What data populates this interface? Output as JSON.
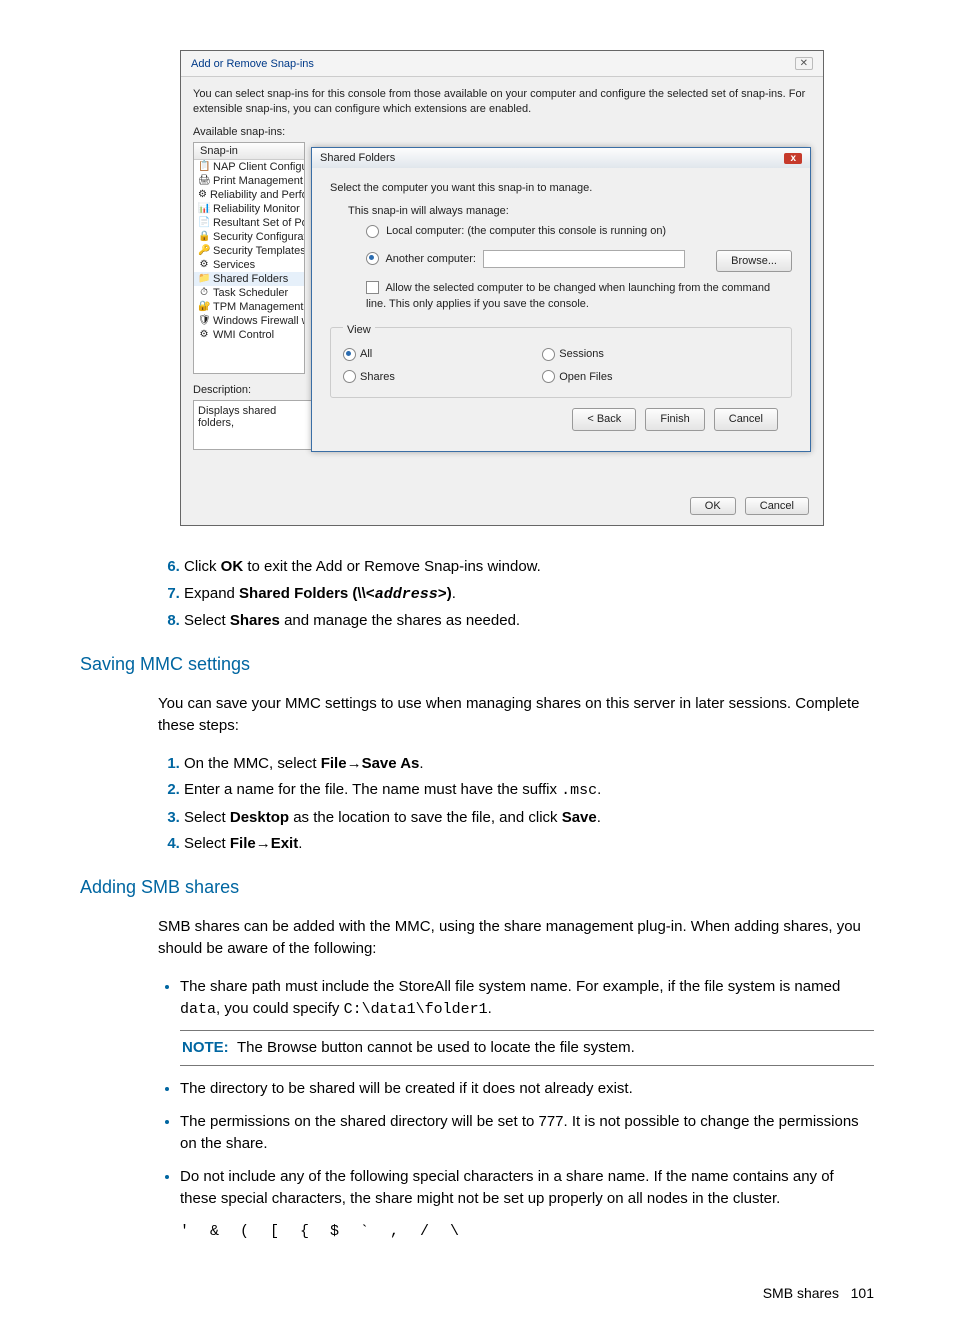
{
  "dialog": {
    "title": "Add or Remove Snap-ins",
    "close": "✕",
    "instructions": "You can select snap-ins for this console from those available on your computer and configure the selected set of snap-ins. For extensible snap-ins, you can configure which extensions are enabled.",
    "available_label": "Available snap-ins:",
    "list_header": "Snap-in",
    "snapins": [
      "NAP Client Configur",
      "Print Management",
      "Reliability and Perfo",
      "Reliability Monitor",
      "Resultant Set of Pol",
      "Security Configurati",
      "Security Templates",
      "Services",
      "Shared Folders",
      "Task Scheduler",
      "TPM Management",
      "Windows Firewall wi",
      "WMI Control"
    ],
    "selected_index": 8,
    "description_label": "Description:",
    "description_text": "Displays shared folders,",
    "ok": "OK",
    "cancel": "Cancel"
  },
  "inner": {
    "title": "Shared Folders",
    "close": "x",
    "instr": "Select the computer you want this snap-in to manage.",
    "always": "This snap-in will always manage:",
    "local": "Local computer:  (the computer this console is running on)",
    "another": "Another computer:",
    "browse": "Browse...",
    "allow": "Allow the selected computer to be changed when launching from the command line.  This only applies if you save the console.",
    "view": "View",
    "opt_all": "All",
    "opt_sessions": "Sessions",
    "opt_shares": "Shares",
    "opt_openfiles": "Open Files",
    "back": "< Back",
    "finish": "Finish",
    "cancel": "Cancel"
  },
  "doc": {
    "step6_a": "Click ",
    "step6_b": "OK",
    "step6_c": " to exit the Add or Remove Snap-ins window.",
    "step7_a": "Expand ",
    "step7_b": "Shared Folders (\\\\",
    "step7_c": "<address>",
    "step7_d": ")",
    "step7_e": ".",
    "step8_a": "Select ",
    "step8_b": "Shares",
    "step8_c": " and manage the shares as needed.",
    "h_saving": "Saving MMC settings",
    "saving_intro": "You can save your MMC settings to use when managing shares on this server in later sessions. Complete these steps:",
    "s1_a": "On the MMC, select ",
    "s1_b": "File",
    "s1_arrow": "→",
    "s1_c": "Save As",
    "s1_d": ".",
    "s2_a": "Enter a name for the file. The name must have the suffix ",
    "s2_b": ".msc",
    "s2_c": ".",
    "s3_a": "Select ",
    "s3_b": "Desktop",
    "s3_c": " as the location to save the file, and click ",
    "s3_d": "Save",
    "s3_e": ".",
    "s4_a": "Select ",
    "s4_b": "File",
    "s4_c": "Exit",
    "s4_d": ".",
    "h_adding": "Adding SMB shares",
    "adding_intro": "SMB shares can be added with the MMC, using the share management plug-in. When adding shares, you should be aware of the following:",
    "b1_a": "The share path must include the StoreAll file system name. For example, if the file system is named ",
    "b1_b": "data",
    "b1_c": ", you could specify ",
    "b1_d": "C:\\data1\\folder1",
    "b1_e": ".",
    "note_label": "NOTE:",
    "note_text": "The Browse button cannot be used to locate the file system.",
    "b2": "The directory to be shared will be created if it does not already exist.",
    "b3": "The permissions on the shared directory will be set to 777. It is not possible to change the permissions on the share.",
    "b4": "Do not include any of the following special characters in a share name. If the name contains any of these special characters, the share might not be set up properly on all nodes in the cluster.",
    "chars": "' & ( [ { $ ` , / \\",
    "footer_text": "SMB shares",
    "footer_page": "101"
  }
}
